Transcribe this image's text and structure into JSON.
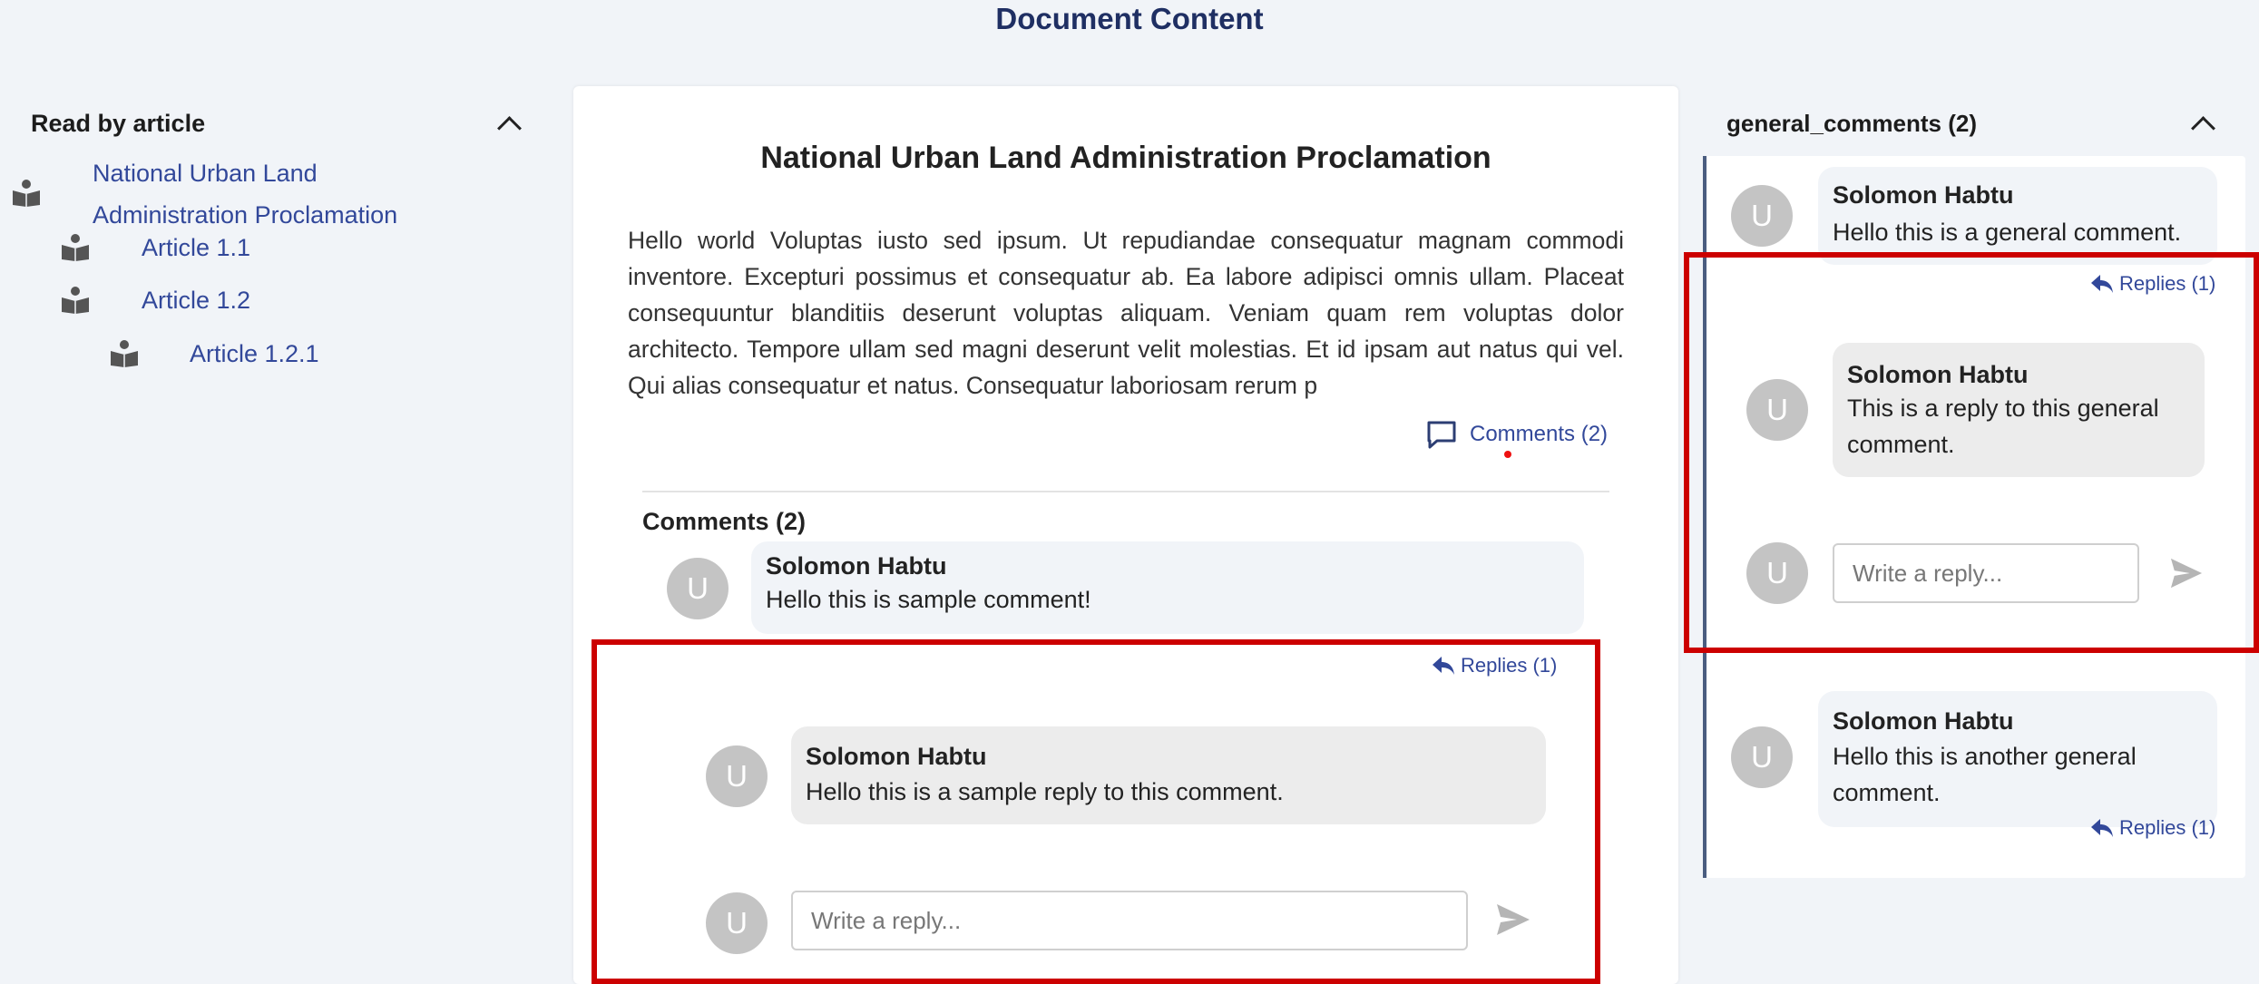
{
  "page": {
    "title": "Document Content"
  },
  "toc": {
    "title": "Read by article",
    "items": [
      {
        "label_line1": "National Urban Land",
        "label_line2": "Administration Proclamation"
      },
      {
        "label": "Article 1.1"
      },
      {
        "label": "Article 1.2"
      },
      {
        "label": "Article 1.2.1"
      }
    ]
  },
  "document": {
    "heading": "National Urban Land Administration Proclamation",
    "body": "Hello world Voluptas iusto sed ipsum. Ut repudiandae consequatur magnam commodi inventore. Excepturi possimus et consequatur ab. Ea labore adipisci omnis ullam. Placeat consequuntur blanditiis deserunt voluptas aliquam. Veniam quam rem voluptas dolor architecto. Tempore ullam sed magni deserunt velit molestias. Et id ipsam aut natus qui vel. Qui alias consequatur et natus. Consequatur laboriosam rerum p",
    "comments_link": "Comments (2)",
    "comments_heading": "Comments (2)",
    "comments": [
      {
        "avatar": "U",
        "author": "Solomon Habtu",
        "text": "Hello this is sample comment!",
        "replies_label": "Replies (1)",
        "replies": [
          {
            "avatar": "U",
            "author": "Solomon Habtu",
            "text": "Hello this is a sample reply to this comment."
          }
        ],
        "reply_avatar": "U",
        "reply_placeholder": "Write a reply..."
      }
    ]
  },
  "general_comments": {
    "title": "general_comments (2)",
    "items": [
      {
        "avatar": "U",
        "author": "Solomon Habtu",
        "text": "Hello this is a general comment.",
        "replies_label": "Replies (1)",
        "replies": [
          {
            "avatar": "U",
            "author": "Solomon Habtu",
            "text_line1": "This is a reply to this general",
            "text_line2": "comment."
          }
        ],
        "reply_avatar": "U",
        "reply_placeholder": "Write a reply..."
      },
      {
        "avatar": "U",
        "author": "Solomon Habtu",
        "text_line1": "Hello this is another general",
        "text_line2": "comment.",
        "replies_label": "Replies (1)"
      }
    ]
  },
  "icons": {
    "collapse": "chevron-up-icon",
    "article": "book-reader-icon",
    "comment": "comment-icon",
    "reply": "reply-arrow-icon",
    "send": "send-icon"
  },
  "colors": {
    "link": "#32489a",
    "title": "#1f2f63",
    "highlight": "#cc0000",
    "background": "#f1f4f8"
  }
}
